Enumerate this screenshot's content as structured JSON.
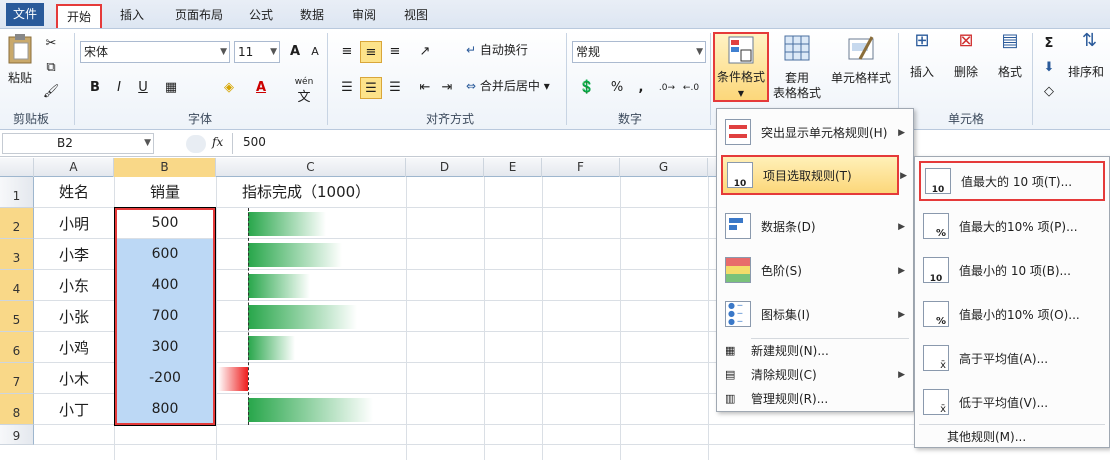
{
  "tabs": [
    "文件",
    "开始",
    "插入",
    "页面布局",
    "公式",
    "数据",
    "审阅",
    "视图"
  ],
  "clipboard": {
    "paste": "粘贴",
    "group": "剪贴板"
  },
  "font": {
    "name": "宋体",
    "size": "11",
    "bold": "B",
    "italic": "I",
    "underline": "U",
    "grow": "A",
    "shrink": "A",
    "wen": "wén",
    "wen2": "文",
    "font_color": "A",
    "group": "字体"
  },
  "align": {
    "wrap": "自动换行",
    "merge": "合并后居中",
    "group": "对齐方式"
  },
  "number": {
    "format": "常规",
    "percent": "%",
    "comma": ",",
    "group": "数字"
  },
  "styles": {
    "cond_format": "条件格式",
    "table_format1": "套用",
    "table_format2": "表格格式",
    "cell_style": "单元格样式"
  },
  "cells": {
    "insert": "插入",
    "delete": "删除",
    "format": "格式",
    "group": "单元格"
  },
  "editing": {
    "sigma": "Σ",
    "sort": "排序和"
  },
  "formula": {
    "name_box": "B2",
    "fx": "fx",
    "value": "500"
  },
  "columns": [
    "A",
    "B",
    "C",
    "D",
    "E",
    "F",
    "G"
  ],
  "rows": [
    "1",
    "2",
    "3",
    "4",
    "5",
    "6",
    "7",
    "8",
    "9"
  ],
  "headers": {
    "name": "姓名",
    "sales": "销量",
    "target": "指标完成（1000）"
  },
  "data": [
    {
      "name": "小明",
      "sales": "500"
    },
    {
      "name": "小李",
      "sales": "600"
    },
    {
      "name": "小东",
      "sales": "400"
    },
    {
      "name": "小张",
      "sales": "700"
    },
    {
      "name": "小鸡",
      "sales": "300"
    },
    {
      "name": "小木",
      "sales": "-200"
    },
    {
      "name": "小丁",
      "sales": "800"
    }
  ],
  "bar_fractions": [
    0.5,
    0.6,
    0.4,
    0.7,
    0.3,
    -0.2,
    0.8
  ],
  "menu1": {
    "items": [
      {
        "label": "突出显示单元格规则(H)"
      },
      {
        "label": "项目选取规则(T)"
      },
      {
        "label": "数据条(D)"
      },
      {
        "label": "色阶(S)"
      },
      {
        "label": "图标集(I)"
      },
      {
        "label": "新建规则(N)..."
      },
      {
        "label": "清除规则(C)"
      },
      {
        "label": "管理规则(R)..."
      }
    ]
  },
  "menu2": {
    "items": [
      {
        "label": "值最大的 10 项(T)...",
        "badge": "10"
      },
      {
        "label": "值最大的10% 项(P)...",
        "badge": "%"
      },
      {
        "label": "值最小的 10 项(B)...",
        "badge": "10"
      },
      {
        "label": "值最小的10% 项(O)...",
        "badge": "%"
      },
      {
        "label": "高于平均值(A)...",
        "badge": "x̄"
      },
      {
        "label": "低于平均值(V)...",
        "badge": "x̄"
      },
      {
        "label": "其他规则(M)..."
      }
    ]
  },
  "colors": {
    "accent_red": "#e53a3a",
    "bar_green": "#27a64a",
    "selection": "#bcd8f5"
  }
}
